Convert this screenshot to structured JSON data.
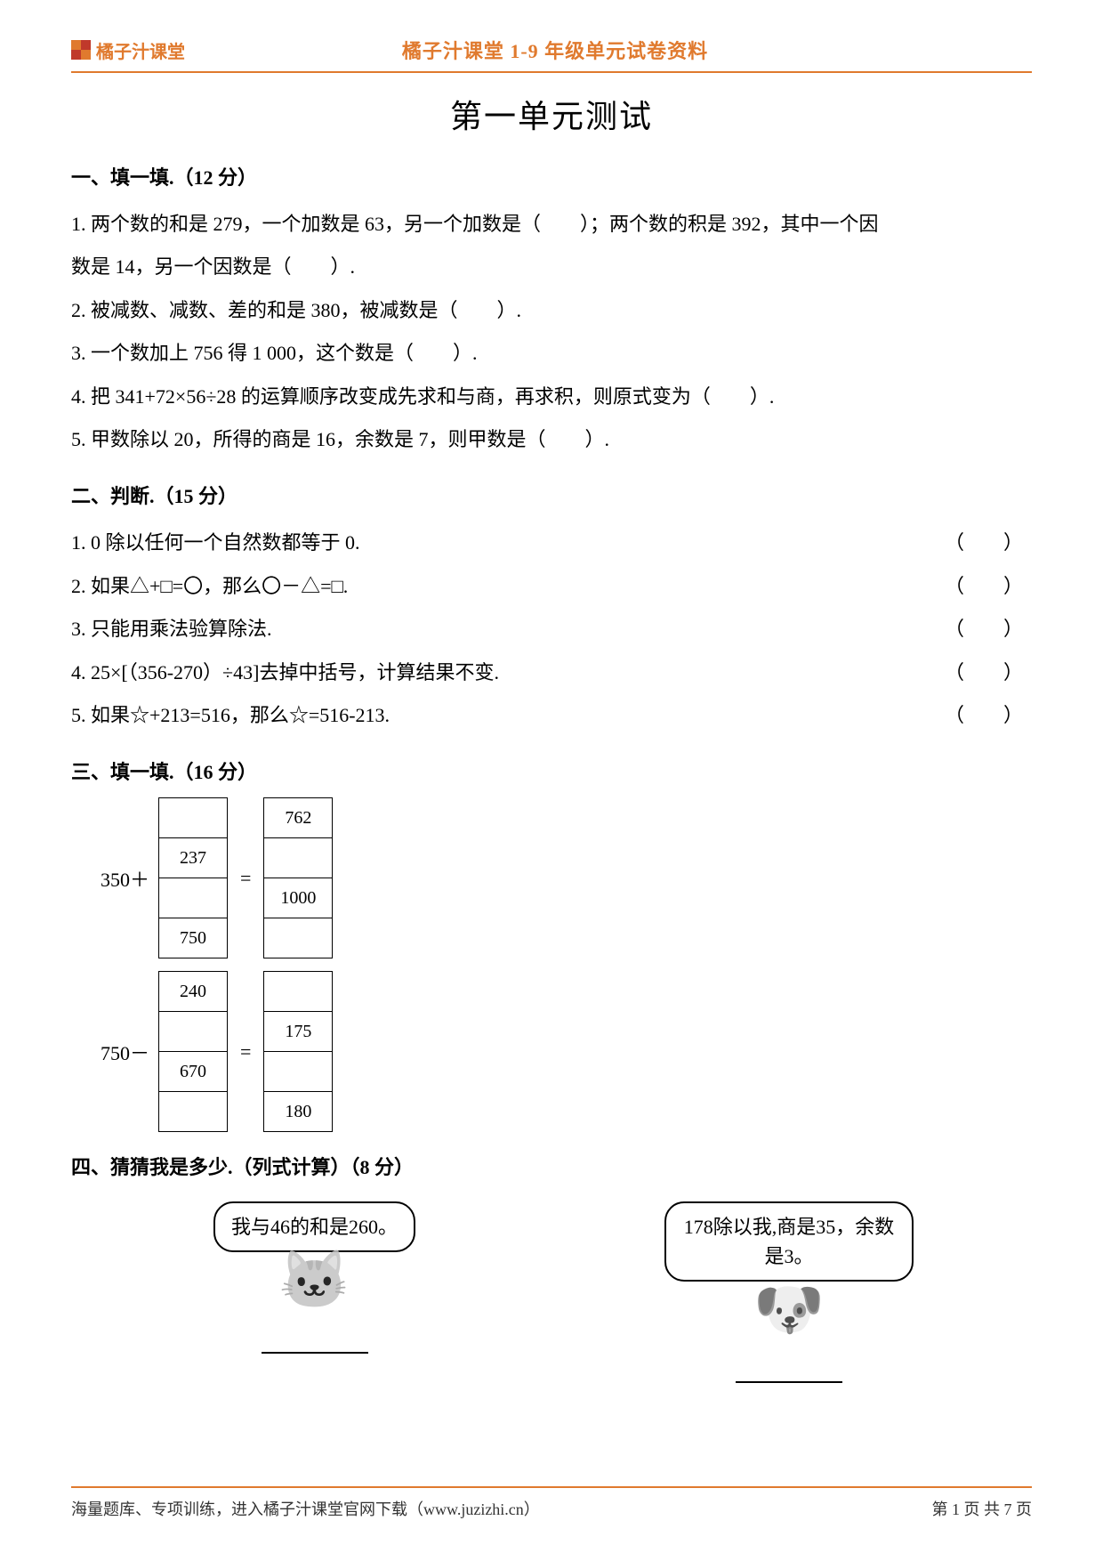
{
  "brand_text": "橘子汁课堂",
  "header_title": "橘子汁课堂 1-9 年级单元试卷资料",
  "main_title": "第一单元测试",
  "sec1": {
    "title": "一、填一填.（12 分）",
    "q1a": "1. 两个数的和是 279，一个加数是 63，另一个加数是（　　）；两个数的积是 392，其中一个因",
    "q1b": "数是 14，另一个因数是（　　）.",
    "q2": "2. 被减数、减数、差的和是 380，被减数是（　　）.",
    "q3": "3. 一个数加上 756 得 1 000，这个数是（　　）.",
    "q4": "4. 把 341+72×56÷28 的运算顺序改变成先求和与商，再求积，则原式变为（　　）.",
    "q5": "5. 甲数除以 20，所得的商是 16，余数是 7，则甲数是（　　）."
  },
  "sec2": {
    "title": "二、判断.（15 分）",
    "paren": "（　　）",
    "q1": "1. 0 除以任何一个自然数都等于 0.",
    "q2": "2. 如果△+□=〇，那么〇－△=□.",
    "q3": "3. 只能用乘法验算除法.",
    "q4": "4. 25×[（356-270）÷43]去掉中括号，计算结果不变.",
    "q5": "5. 如果☆+213=516，那么☆=516-213."
  },
  "sec3": {
    "title": "三、填一填.（16 分）",
    "row1": {
      "label": "350＋",
      "left": [
        "",
        "237",
        "",
        "750"
      ],
      "right": [
        "762",
        "",
        "1000",
        ""
      ]
    },
    "row2": {
      "label": "750－",
      "left": [
        "240",
        "",
        "670",
        ""
      ],
      "right": [
        "",
        "175",
        "",
        "180"
      ]
    },
    "eq": "="
  },
  "sec4": {
    "title": "四、猜猜我是多少.（列式计算）（8 分）",
    "b1": "我与46的和是260。",
    "b2": "178除以我,商是35，余数是3。"
  },
  "footer_left": "海量题库、专项训练，进入橘子汁课堂官网下载（www.juzizhi.cn）",
  "footer_right": "第 1 页 共 7 页"
}
